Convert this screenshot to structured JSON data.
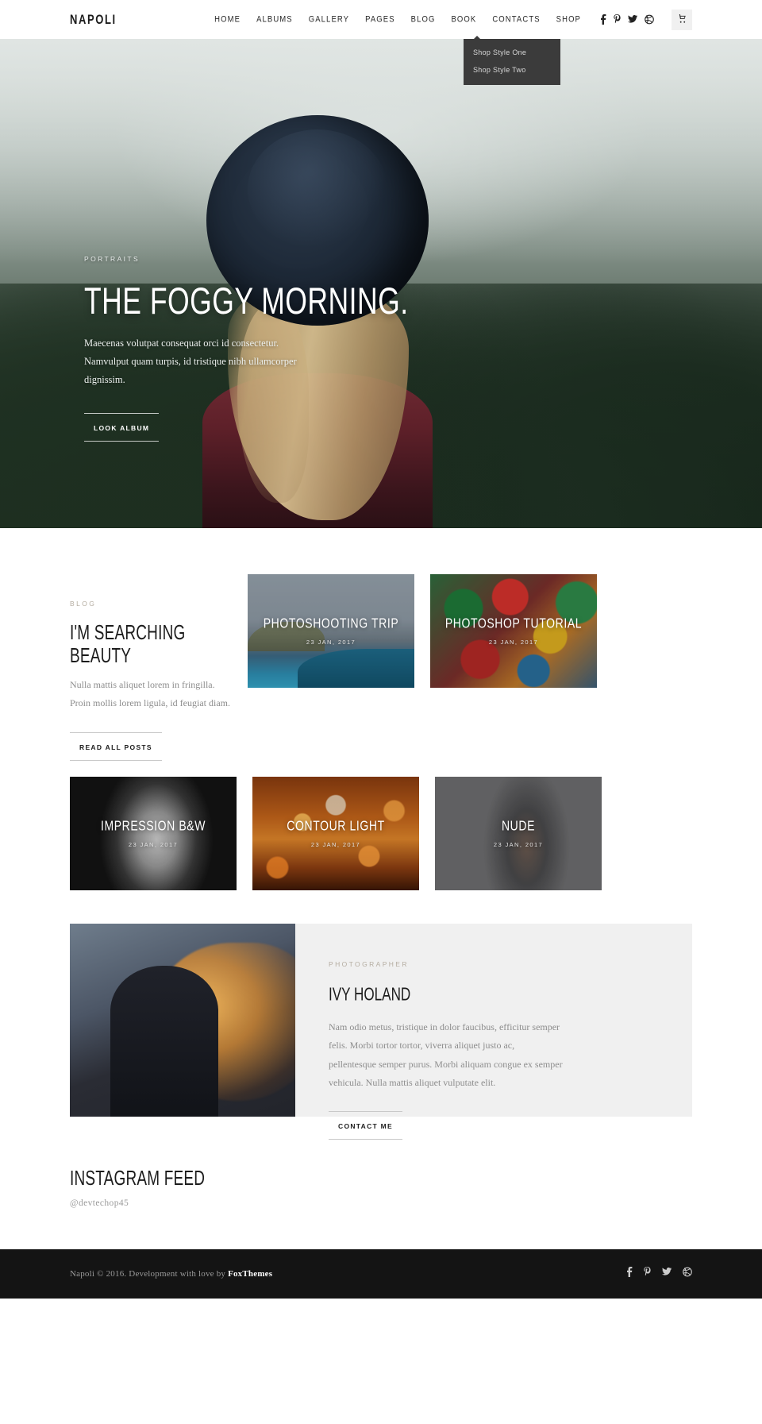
{
  "header": {
    "brand": "NAPOLI",
    "nav": [
      {
        "label": "HOME"
      },
      {
        "label": "ALBUMS"
      },
      {
        "label": "GALLERY"
      },
      {
        "label": "PAGES"
      },
      {
        "label": "BLOG"
      },
      {
        "label": "BOOK"
      },
      {
        "label": "CONTACTS"
      },
      {
        "label": "SHOP"
      }
    ],
    "social": [
      "facebook-icon",
      "pinterest-icon",
      "twitter-icon",
      "dribbble-icon"
    ],
    "cart_icon": "shopping-cart-icon",
    "dropdown": {
      "parent": "SHOP",
      "items": [
        {
          "label": "Shop Style One"
        },
        {
          "label": "Shop Style Two"
        }
      ]
    }
  },
  "hero": {
    "kicker": "PORTRAITS",
    "title": "THE FOGGY MORNING.",
    "text": "Maecenas volutpat consequat orci id consectetur. Namvulput quam turpis, id tristique nibh ullamcorper dignissim.",
    "button": "LOOK ALBUM"
  },
  "blog": {
    "kicker": "BLOG",
    "heading": "I'M SEARCHING BEAUTY",
    "text": "Nulla mattis aliquet lorem in fringilla. Proin mollis lorem ligula, id feugiat diam.",
    "button": "READ ALL POSTS",
    "posts": [
      {
        "title": "PHOTOSHOOTING TRIP",
        "date": "23 JAN, 2017"
      },
      {
        "title": "PHOTOSHOP TUTORIAL",
        "date": "23 JAN, 2017"
      },
      {
        "title": "IMPRESSION B&W",
        "date": "23 JAN, 2017"
      },
      {
        "title": "CONTOUR LIGHT",
        "date": "23 JAN, 2017"
      },
      {
        "title": "NUDE",
        "date": "23 JAN, 2017"
      }
    ]
  },
  "photographer": {
    "kicker": "PHOTOGRAPHER",
    "name": "IVY HOLAND",
    "text": "Nam odio metus, tristique in dolor faucibus, efficitur semper felis. Morbi tortor tortor, viverra aliquet justo ac, pellentesque semper purus. Morbi aliquam congue ex semper vehicula. Nulla mattis aliquet vulputate elit.",
    "button": "CONTACT ME"
  },
  "instagram": {
    "heading": "INSTAGRAM FEED",
    "handle": "@devtechop45"
  },
  "footer": {
    "text_before": "Napoli © 2016. Development with love by ",
    "brand": "FoxThemes",
    "social": [
      "facebook-icon",
      "pinterest-icon",
      "twitter-icon",
      "dribbble-icon"
    ]
  },
  "colors": {
    "accent_muted": "#b5ada1",
    "text_dark": "#1c1c1c",
    "footer_bg": "#141414",
    "dropdown_bg": "#3b3b3b"
  }
}
